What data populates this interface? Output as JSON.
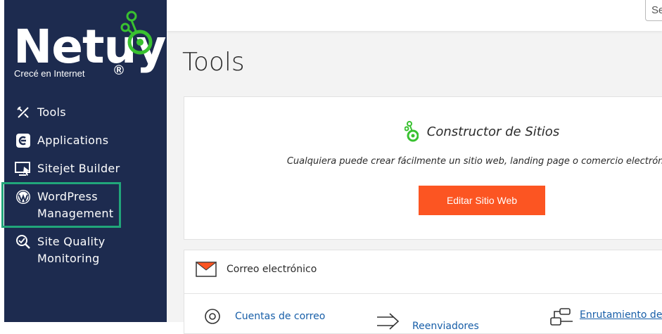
{
  "sidebar": {
    "logo": {
      "wordmark": "Netuy",
      "tagline": "Crecé en Internet",
      "reg": "®"
    },
    "items": [
      {
        "label": "Tools",
        "icon": "tools-icon"
      },
      {
        "label": "Applications",
        "icon": "applications-icon"
      },
      {
        "label": "Sitejet Builder",
        "icon": "sitejet-icon"
      },
      {
        "label": "WordPress\nManagement",
        "icon": "wordpress-icon",
        "highlighted": true
      },
      {
        "label": "Site Quality\nMonitoring",
        "icon": "site-quality-icon"
      }
    ]
  },
  "header": {
    "search_text": "Se"
  },
  "main": {
    "title": "Tools",
    "builder": {
      "title": "Constructor de Sitios",
      "description": "Cualquiera puede crear fácilmente un sitio web, landing page o comercio electrónico",
      "button": "Editar Sitio Web"
    },
    "email": {
      "title": "Correo electrónico",
      "tools": [
        {
          "label": "Cuentas de correo",
          "icon": "email-accounts-icon"
        },
        {
          "label": "Reenviadores",
          "icon": "forwarders-icon"
        },
        {
          "label": "Enrutamiento de",
          "icon": "email-routing-icon"
        }
      ]
    }
  },
  "colors": {
    "sidebar": "#1d2b4f",
    "accent_green": "#39c130",
    "button": "#fc5522",
    "highlight": "#21a67a",
    "link": "#175ea8"
  }
}
